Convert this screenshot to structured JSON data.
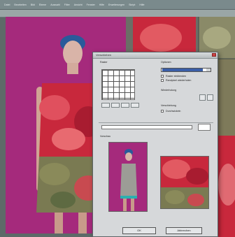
{
  "menubar": {
    "items": [
      "Datei",
      "Bearbeiten",
      "Bild",
      "Ebene",
      "Auswahl",
      "Filter",
      "Ansicht",
      "Fenster",
      "Hilfe",
      "Erweiterungen",
      "Skript",
      "Hilfe"
    ]
  },
  "dialog": {
    "title": "Verschieben",
    "sections": {
      "grid_label": "Raster",
      "options_label": "Optionen",
      "preview_label": "Vorschau",
      "offset_label": "Verschiebung",
      "repeat_label": "Wiederholung"
    },
    "checkboxes": [
      "Raster einblenden",
      "Randpixel wiederholen",
      "Durchwickeln"
    ],
    "buttons": {
      "ok": "OK",
      "cancel": "Abbrechen"
    }
  },
  "colors": {
    "background_left": "#a52a7c",
    "dialog_bg": "#d6d8da",
    "selection": "#3a5ea8"
  }
}
